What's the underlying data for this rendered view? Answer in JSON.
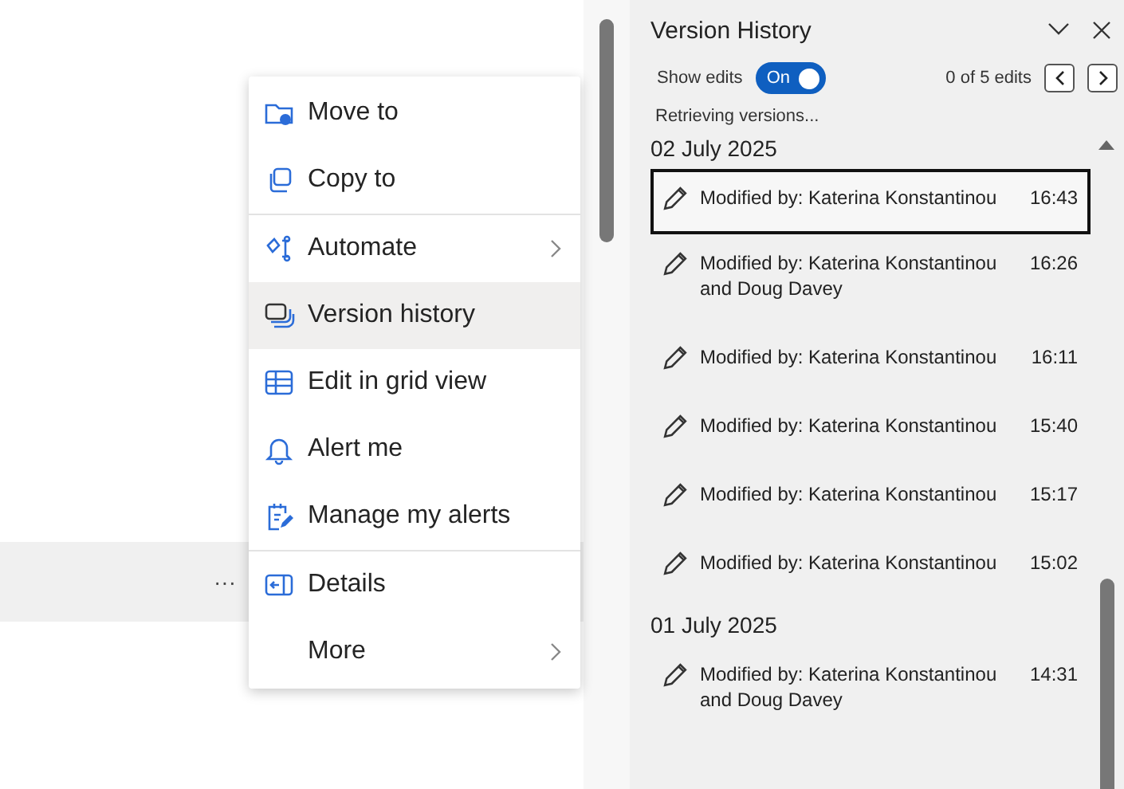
{
  "page": {
    "row_action": "···"
  },
  "menu": {
    "groups": [
      {
        "items": [
          {
            "label": "Move to",
            "selected": false,
            "has_submenu": false
          },
          {
            "label": "Copy to",
            "selected": false,
            "has_submenu": false
          }
        ]
      },
      {
        "items": [
          {
            "label": "Automate",
            "selected": false,
            "has_submenu": true
          },
          {
            "label": "Version history",
            "selected": true,
            "has_submenu": false
          },
          {
            "label": "Edit in grid view",
            "selected": false,
            "has_submenu": false
          },
          {
            "label": "Alert me",
            "selected": false,
            "has_submenu": false
          },
          {
            "label": "Manage my alerts",
            "selected": false,
            "has_submenu": false
          }
        ]
      },
      {
        "items": [
          {
            "label": "Details",
            "selected": false,
            "has_submenu": false
          },
          {
            "label": "More",
            "selected": false,
            "has_submenu": true
          }
        ]
      }
    ]
  },
  "panel": {
    "title": "Version History",
    "show_edits": {
      "label": "Show edits",
      "on": true,
      "state_label": "On"
    },
    "edit_count": "0 of 5 edits",
    "status": "Retrieving versions...",
    "days": [
      {
        "date": "02 July 2025",
        "versions": [
          {
            "author": "Modified by: Katerina Konstantinou",
            "time": "16:43",
            "selected": true
          },
          {
            "author": "Modified by: Katerina Konstantinou and Doug Davey",
            "time": "16:26",
            "selected": false
          },
          {
            "author": "Modified by: Katerina Konstantinou",
            "time": "16:11",
            "selected": false
          },
          {
            "author": "Modified by: Katerina Konstantinou",
            "time": "15:40",
            "selected": false
          },
          {
            "author": "Modified by: Katerina Konstantinou",
            "time": "15:17",
            "selected": false
          },
          {
            "author": "Modified by: Katerina Konstantinou",
            "time": "15:02",
            "selected": false
          }
        ]
      },
      {
        "date": "01 July 2025",
        "versions": [
          {
            "author": "Modified by: Katerina Konstantinou and Doug Davey",
            "time": "14:31",
            "selected": false
          }
        ]
      }
    ]
  }
}
